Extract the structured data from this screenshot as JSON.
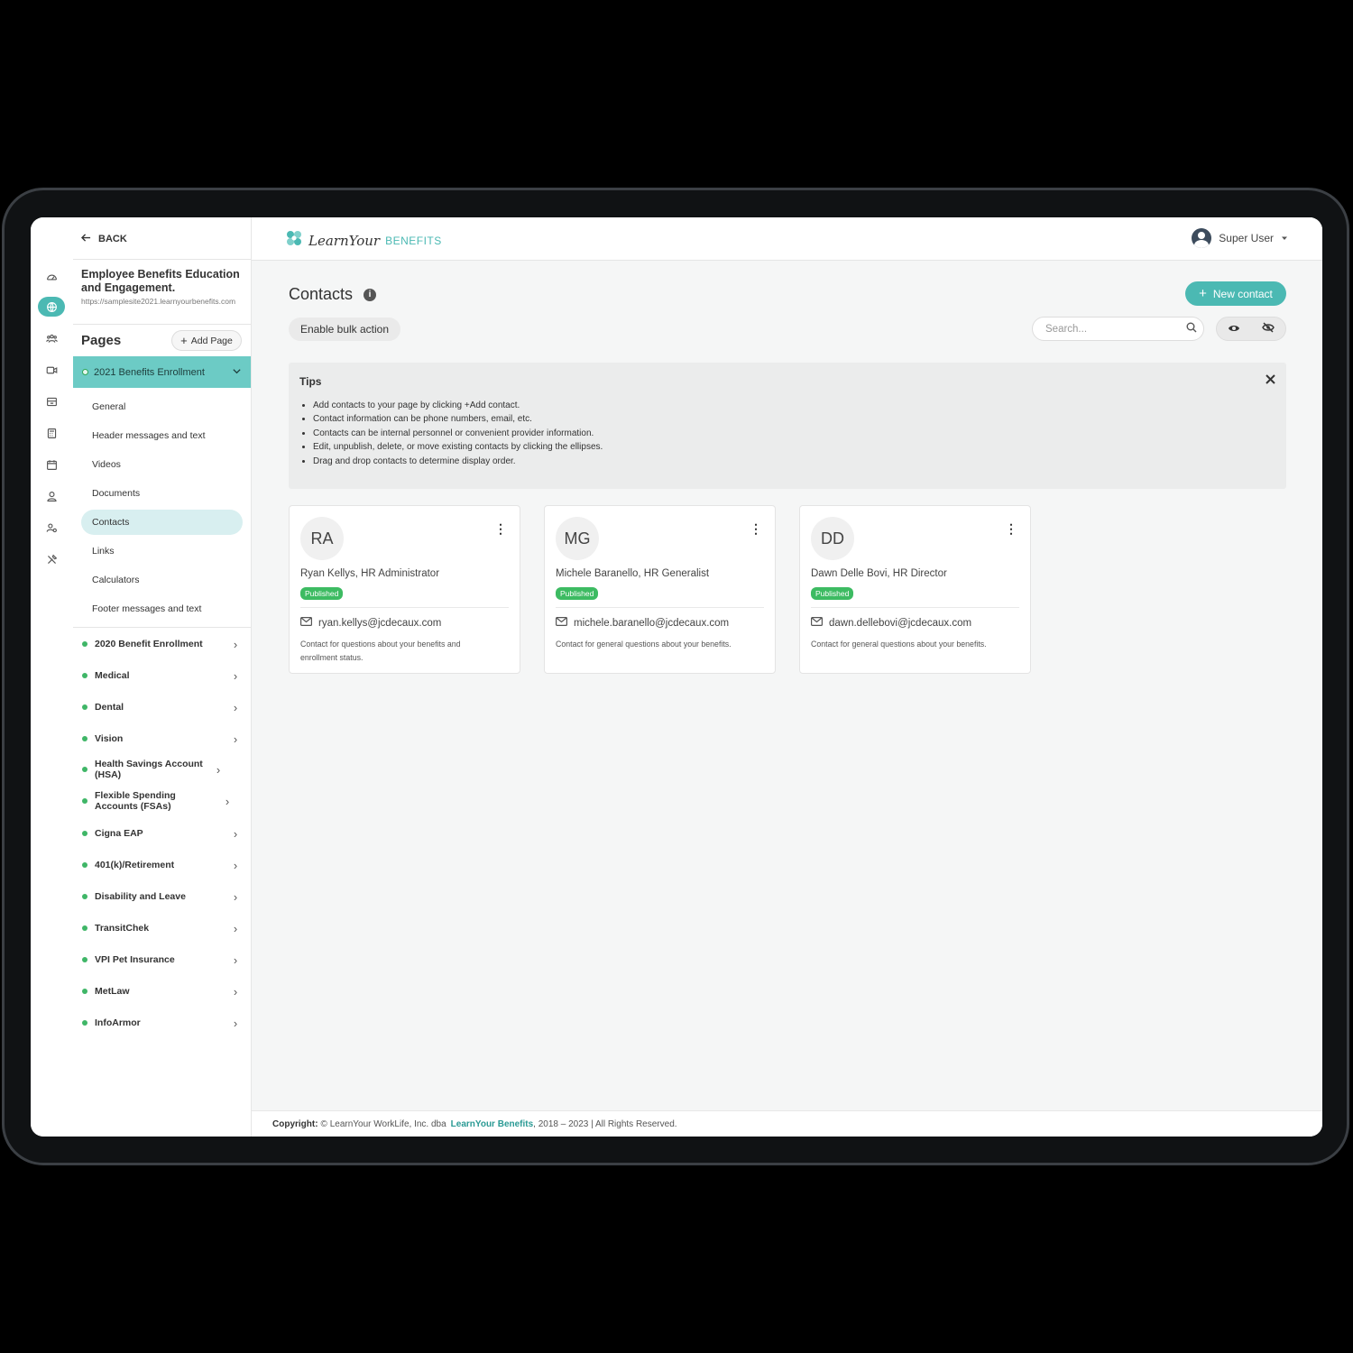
{
  "nav": {
    "back_label": "BACK"
  },
  "site": {
    "title": "Employee Benefits Education and Engagement.",
    "url": "https://samplesite2021.learnyourbenefits.com"
  },
  "pages_panel": {
    "title": "Pages",
    "add_page_label": "Add Page",
    "active_page": "2021 Benefits Enrollment",
    "sub_items": [
      "General",
      "Header messages and text",
      "Videos",
      "Documents",
      "Contacts",
      "Links",
      "Calculators",
      "Footer messages and text"
    ],
    "active_sub_item": "Contacts",
    "pages": [
      "2020 Benefit Enrollment",
      "Medical",
      "Dental",
      "Vision",
      "Health Savings Account (HSA)",
      "Flexible Spending Accounts (FSAs)",
      "Cigna EAP",
      "401(k)/Retirement",
      "Disability and Leave",
      "TransitChek",
      "VPI Pet Insurance",
      "MetLaw",
      "InfoArmor"
    ]
  },
  "header": {
    "logo_script": "LearnYour",
    "logo_brand": "BENEFITS",
    "user_name": "Super User"
  },
  "main": {
    "title": "Contacts",
    "new_contact_label": "New contact",
    "bulk_action_label": "Enable bulk action",
    "search_placeholder": "Search..."
  },
  "tips": {
    "title": "Tips",
    "items": [
      "Add contacts to your page by clicking +Add contact.",
      "Contact information can be phone numbers, email, etc.",
      "Contacts can be internal personnel or convenient provider information.",
      "Edit, unpublish, delete, or move existing contacts by clicking the ellipses.",
      "Drag and drop contacts to determine display order."
    ]
  },
  "contacts": [
    {
      "initials": "RA",
      "name": "Ryan Kellys, HR Administrator",
      "status": "Published",
      "email": "ryan.kellys@jcdecaux.com",
      "description": "Contact for questions about your benefits and enrollment status."
    },
    {
      "initials": "MG",
      "name": "Michele Baranello, HR Generalist",
      "status": "Published",
      "email": "michele.baranello@jcdecaux.com",
      "description": "Contact for general questions about your benefits."
    },
    {
      "initials": "DD",
      "name": "Dawn Delle Bovi, HR Director",
      "status": "Published",
      "email": "dawn.dellebovi@jcdecaux.com",
      "description": "Contact for general questions about your benefits."
    }
  ],
  "footer": {
    "label": "Copyright:",
    "text_before": "© LearnYour WorkLife, Inc. dba",
    "brand": "LearnYour Benefits",
    "text_after": ", 2018 – 2023 | All Rights Reserved."
  },
  "colors": {
    "accent": "#4bb9b3",
    "published": "#3dbb62",
    "status_dot": "#3fb667"
  },
  "icons": {
    "rail": [
      "dashboard-icon",
      "globe-icon",
      "users-icon",
      "video-icon",
      "inbox-icon",
      "calculator-icon",
      "calendar-icon",
      "user-icon",
      "user-settings-icon",
      "tools-icon"
    ]
  }
}
